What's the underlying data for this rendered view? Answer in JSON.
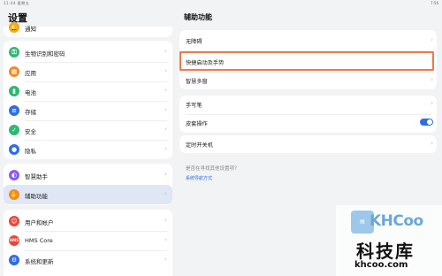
{
  "status_bar": {
    "left": "11:44 星期五",
    "right": "7:56"
  },
  "left_pane": {
    "title": "设置",
    "top_partial_item": {
      "label": "通知",
      "icon": "bell-icon",
      "color": "#f5a623"
    },
    "group1": [
      {
        "label": "生物识别和密码",
        "icon": "key-icon",
        "color": "#2eb872"
      },
      {
        "label": "应用",
        "icon": "apps-icon",
        "color": "#f08a24"
      },
      {
        "label": "电池",
        "icon": "battery-icon",
        "color": "#2eb872"
      },
      {
        "label": "存储",
        "icon": "storage-icon",
        "color": "#2f6de1"
      },
      {
        "label": "安全",
        "icon": "shield-icon",
        "color": "#2eb872"
      },
      {
        "label": "隐私",
        "icon": "privacy-icon",
        "color": "#2f6de1"
      }
    ],
    "group2": [
      {
        "label": "智慧助手",
        "icon": "assistant-icon",
        "color": "#8a5cf6"
      },
      {
        "label": "辅助功能",
        "icon": "accessibility-icon",
        "color": "#f08a24",
        "selected": true
      }
    ],
    "group3": [
      {
        "label": "用户和帐户",
        "icon": "user-icon",
        "color": "#e5483a"
      },
      {
        "label": "HMS Core",
        "icon": "hms-icon",
        "color": "#e5483a",
        "glyph": "HMS"
      },
      {
        "label": "系统和更新",
        "icon": "system-update-icon",
        "color": "#2f6de1"
      }
    ]
  },
  "right_pane": {
    "title": "辅助功能",
    "card1": [
      {
        "label": "无障碍"
      },
      {
        "label": "快捷启动及手势",
        "highlighted": true
      },
      {
        "label": "智慧多窗"
      }
    ],
    "card2": [
      {
        "label": "手写笔",
        "control": "chevron"
      },
      {
        "label": "皮套操作",
        "control": "toggle",
        "on": true
      }
    ],
    "card3": [
      {
        "label": "定时开关机"
      }
    ],
    "hint": "是否在寻找其他设置项？",
    "hint_link": "系统导航方式"
  },
  "watermark": {
    "logo_text": "KHCoo",
    "title": "科技库",
    "url": "khcoo.com"
  }
}
